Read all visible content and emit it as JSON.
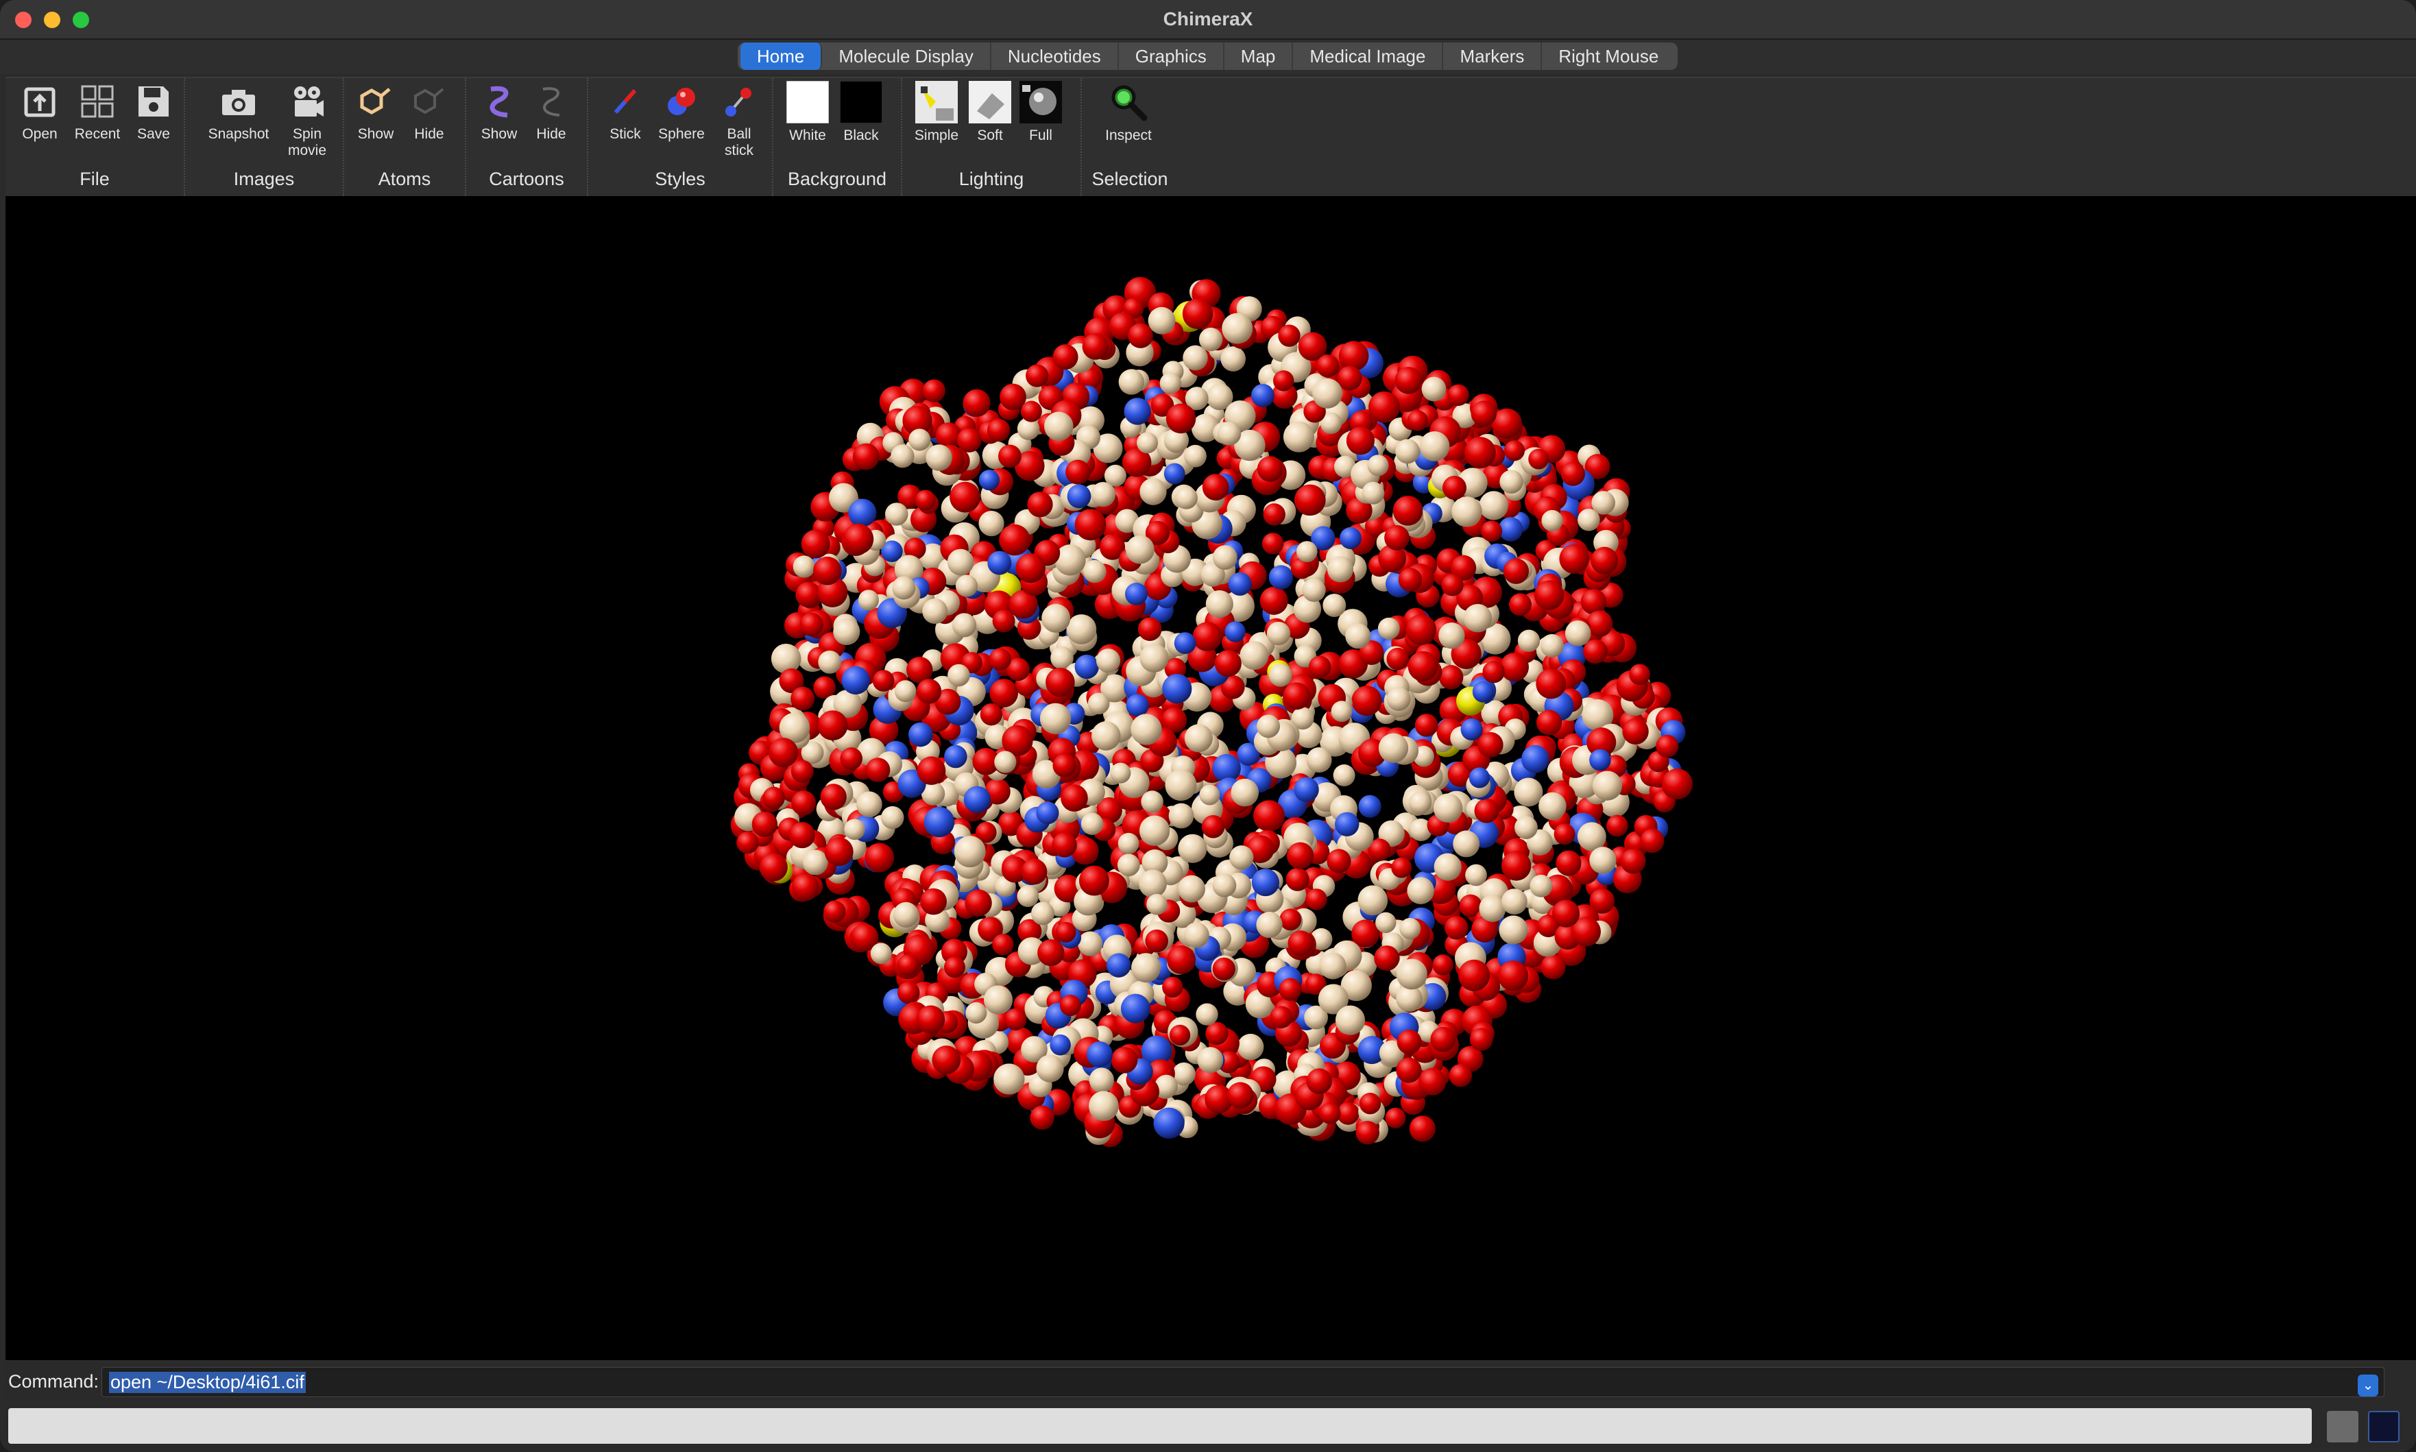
{
  "window": {
    "title": "ChimeraX"
  },
  "tabs": [
    {
      "label": "Home",
      "active": true
    },
    {
      "label": "Molecule Display"
    },
    {
      "label": "Nucleotides"
    },
    {
      "label": "Graphics"
    },
    {
      "label": "Map"
    },
    {
      "label": "Medical Image"
    },
    {
      "label": "Markers"
    },
    {
      "label": "Right Mouse"
    }
  ],
  "toolbar": {
    "file": {
      "label": "File",
      "open": "Open",
      "recent": "Recent",
      "save": "Save"
    },
    "images": {
      "label": "Images",
      "snapshot": "Snapshot",
      "spin_movie_1": "Spin",
      "spin_movie_2": "movie"
    },
    "atoms": {
      "label": "Atoms",
      "show": "Show",
      "hide": "Hide"
    },
    "cartoons": {
      "label": "Cartoons",
      "show": "Show",
      "hide": "Hide"
    },
    "styles": {
      "label": "Styles",
      "stick": "Stick",
      "sphere": "Sphere",
      "ball_stick_1": "Ball",
      "ball_stick_2": "stick"
    },
    "background": {
      "label": "Background",
      "white": "White",
      "black": "Black"
    },
    "lighting": {
      "label": "Lighting",
      "simple": "Simple",
      "soft": "Soft",
      "full": "Full"
    },
    "selection": {
      "label": "Selection",
      "inspect": "Inspect"
    }
  },
  "command": {
    "label": "Command:",
    "value": "open ~/Desktop/4i61.cif"
  },
  "colors": {
    "oxygen": "#e00000",
    "carbon": "#e8d2b0",
    "nitrogen": "#2f55e0",
    "sulfur": "#e6e000",
    "accent": "#2a72d6"
  }
}
